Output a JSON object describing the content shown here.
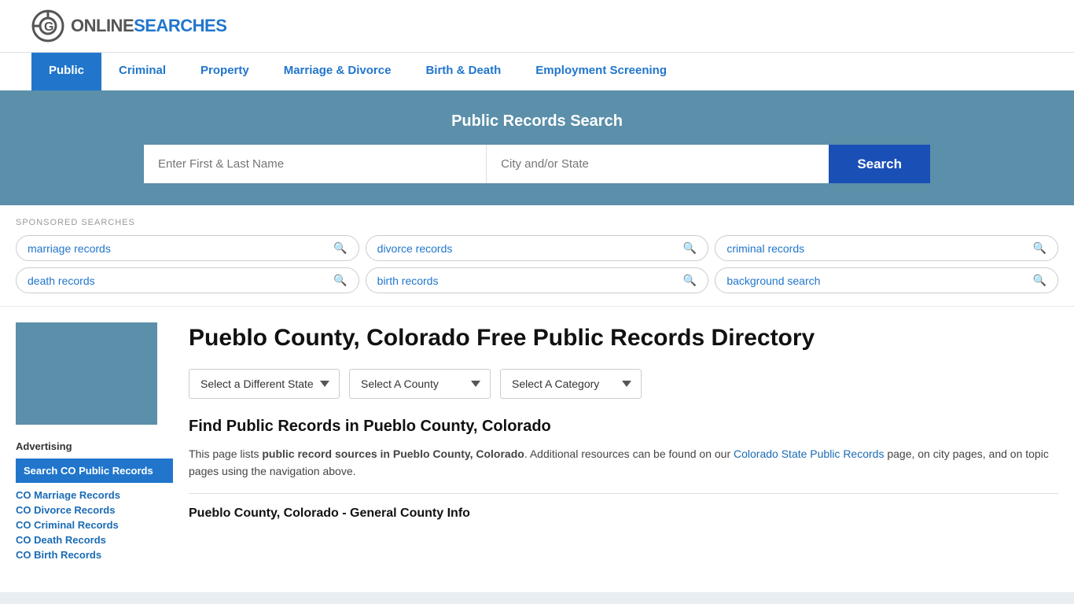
{
  "site": {
    "logo_online": "ONLINE",
    "logo_searches": "SEARCHES"
  },
  "nav": {
    "items": [
      {
        "label": "Public",
        "active": true
      },
      {
        "label": "Criminal",
        "active": false
      },
      {
        "label": "Property",
        "active": false
      },
      {
        "label": "Marriage & Divorce",
        "active": false
      },
      {
        "label": "Birth & Death",
        "active": false
      },
      {
        "label": "Employment Screening",
        "active": false
      }
    ]
  },
  "search_banner": {
    "title": "Public Records Search",
    "name_placeholder": "Enter First & Last Name",
    "location_placeholder": "City and/or State",
    "button_label": "Search"
  },
  "sponsored": {
    "label": "SPONSORED SEARCHES",
    "tags": [
      {
        "label": "marriage records"
      },
      {
        "label": "divorce records"
      },
      {
        "label": "criminal records"
      },
      {
        "label": "death records"
      },
      {
        "label": "birth records"
      },
      {
        "label": "background search"
      }
    ]
  },
  "page": {
    "title": "Pueblo County, Colorado Free Public Records Directory",
    "dropdown_state": "Select a Different State",
    "dropdown_county": "Select A County",
    "dropdown_category": "Select A Category",
    "find_heading": "Find Public Records in Pueblo County, Colorado",
    "description_part1": "This page lists ",
    "description_bold1": "public record sources in Pueblo County, Colorado",
    "description_part2": ". Additional resources can be found on our ",
    "description_link": "Colorado State Public Records",
    "description_part3": " page, on city pages, and on topic pages using the navigation above.",
    "general_info_heading": "Pueblo County, Colorado - General County Info"
  },
  "sidebar": {
    "county_image_alt": "Pueblo County map",
    "advertising_label": "Advertising",
    "ad_highlight": "Search CO Public Records",
    "links": [
      {
        "label": "CO Marriage Records"
      },
      {
        "label": "CO Divorce Records"
      },
      {
        "label": "CO Criminal Records"
      },
      {
        "label": "CO Death Records"
      },
      {
        "label": "CO Birth Records"
      }
    ]
  }
}
